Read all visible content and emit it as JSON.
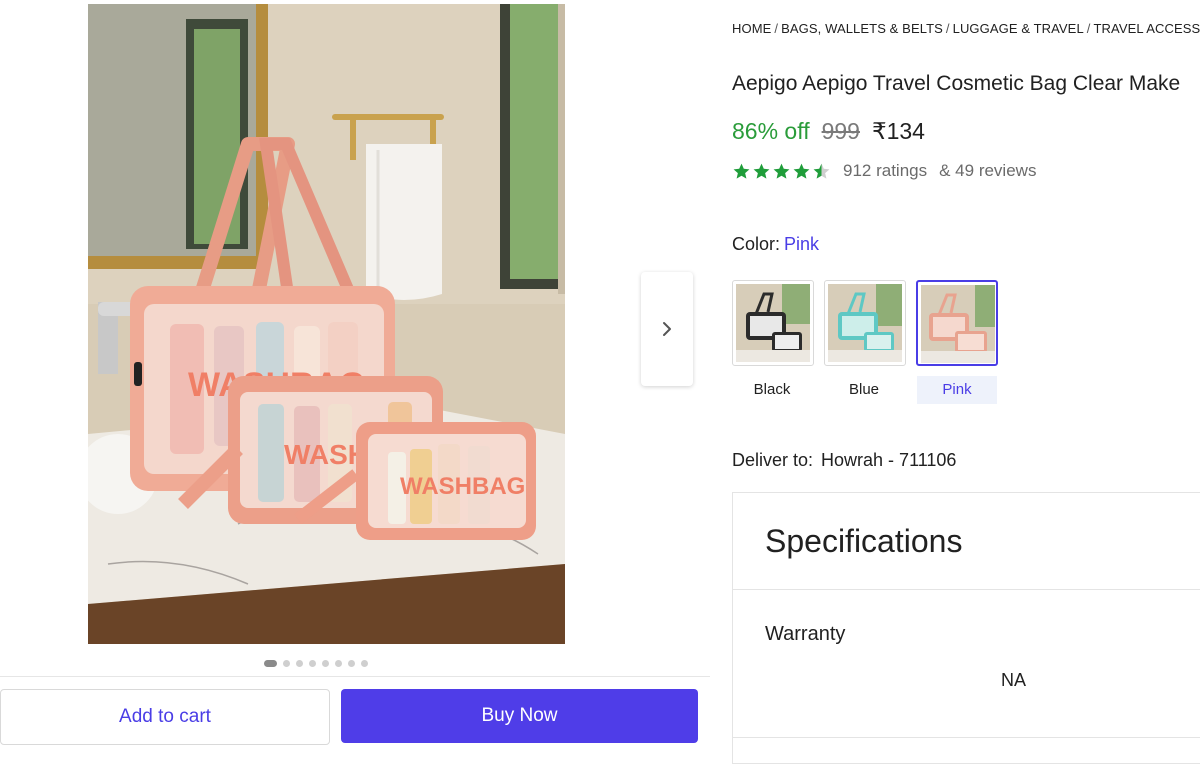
{
  "breadcrumb": {
    "items": [
      "HOME",
      "BAGS, WALLETS & BELTS",
      "LUGGAGE & TRAVEL",
      "TRAVEL ACCESS"
    ]
  },
  "product": {
    "title": "Aepigo Aepigo Travel Cosmetic Bag Clear Make",
    "discount": "86% off",
    "mrp": "999",
    "price": "₹134",
    "rating_value": 4.5,
    "ratings": "912 ratings",
    "reviews": "& 49 reviews",
    "image_text": "WASHBAG"
  },
  "color": {
    "label": "Color:",
    "selected": "Pink",
    "options": [
      {
        "name": "Black",
        "bag_color": "#2b2b2b"
      },
      {
        "name": "Blue",
        "bag_color": "#5ec8c4"
      },
      {
        "name": "Pink",
        "bag_color": "#e8a38f"
      }
    ]
  },
  "delivery": {
    "label": "Deliver to:",
    "location": "Howrah - 711106"
  },
  "specifications": {
    "title": "Specifications",
    "rows": [
      {
        "key": "Warranty",
        "value": "NA"
      }
    ]
  },
  "gallery": {
    "image_count": 8,
    "active_index": 0
  },
  "actions": {
    "add_to_cart": "Add to cart",
    "buy_now": "Buy Now"
  },
  "colors": {
    "accent": "#4f3de8",
    "discount_green": "#2a9c3a",
    "star_green": "#1f9d3a"
  },
  "icons": {
    "next": "chevron-right-icon",
    "star": "star-icon"
  }
}
